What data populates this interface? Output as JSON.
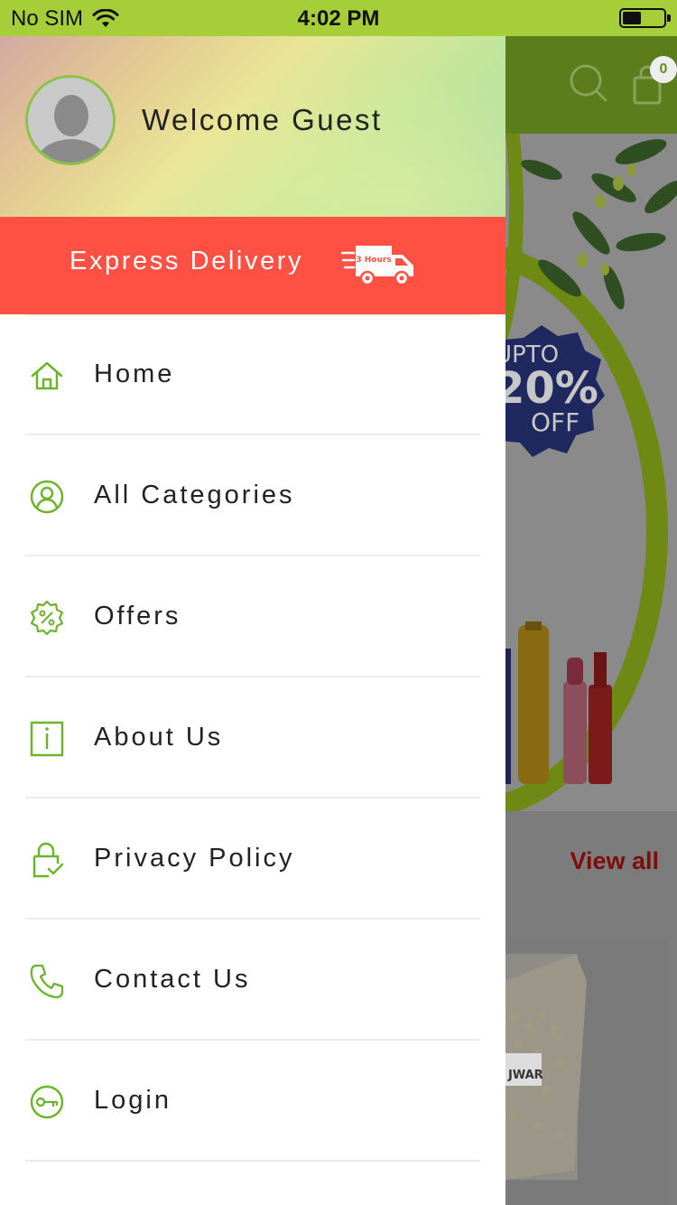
{
  "status_bar": {
    "carrier": "No SIM",
    "time": "4:02 PM"
  },
  "drawer": {
    "welcome_text": "Welcome Guest",
    "express_label": "Express Delivery",
    "truck_badge": "3 Hours",
    "menu": [
      {
        "label": "Home",
        "icon": "home-icon"
      },
      {
        "label": "All Categories",
        "icon": "categories-icon"
      },
      {
        "label": "Offers",
        "icon": "offers-icon"
      },
      {
        "label": "About Us",
        "icon": "info-icon"
      },
      {
        "label": "Privacy Policy",
        "icon": "privacy-icon"
      },
      {
        "label": "Contact Us",
        "icon": "phone-icon"
      },
      {
        "label": "Login",
        "icon": "key-icon"
      }
    ]
  },
  "background_screen": {
    "cart_count": "0",
    "offer_line1": "UPTO",
    "offer_line2": "20%",
    "offer_line3": "OFF",
    "view_all": "View all",
    "product_label": "JWAR"
  },
  "colors": {
    "brand_green": "#a6ce39",
    "icon_green": "#6cb32e",
    "express_red": "#ff5044",
    "view_all_red": "#7e0c0c"
  }
}
